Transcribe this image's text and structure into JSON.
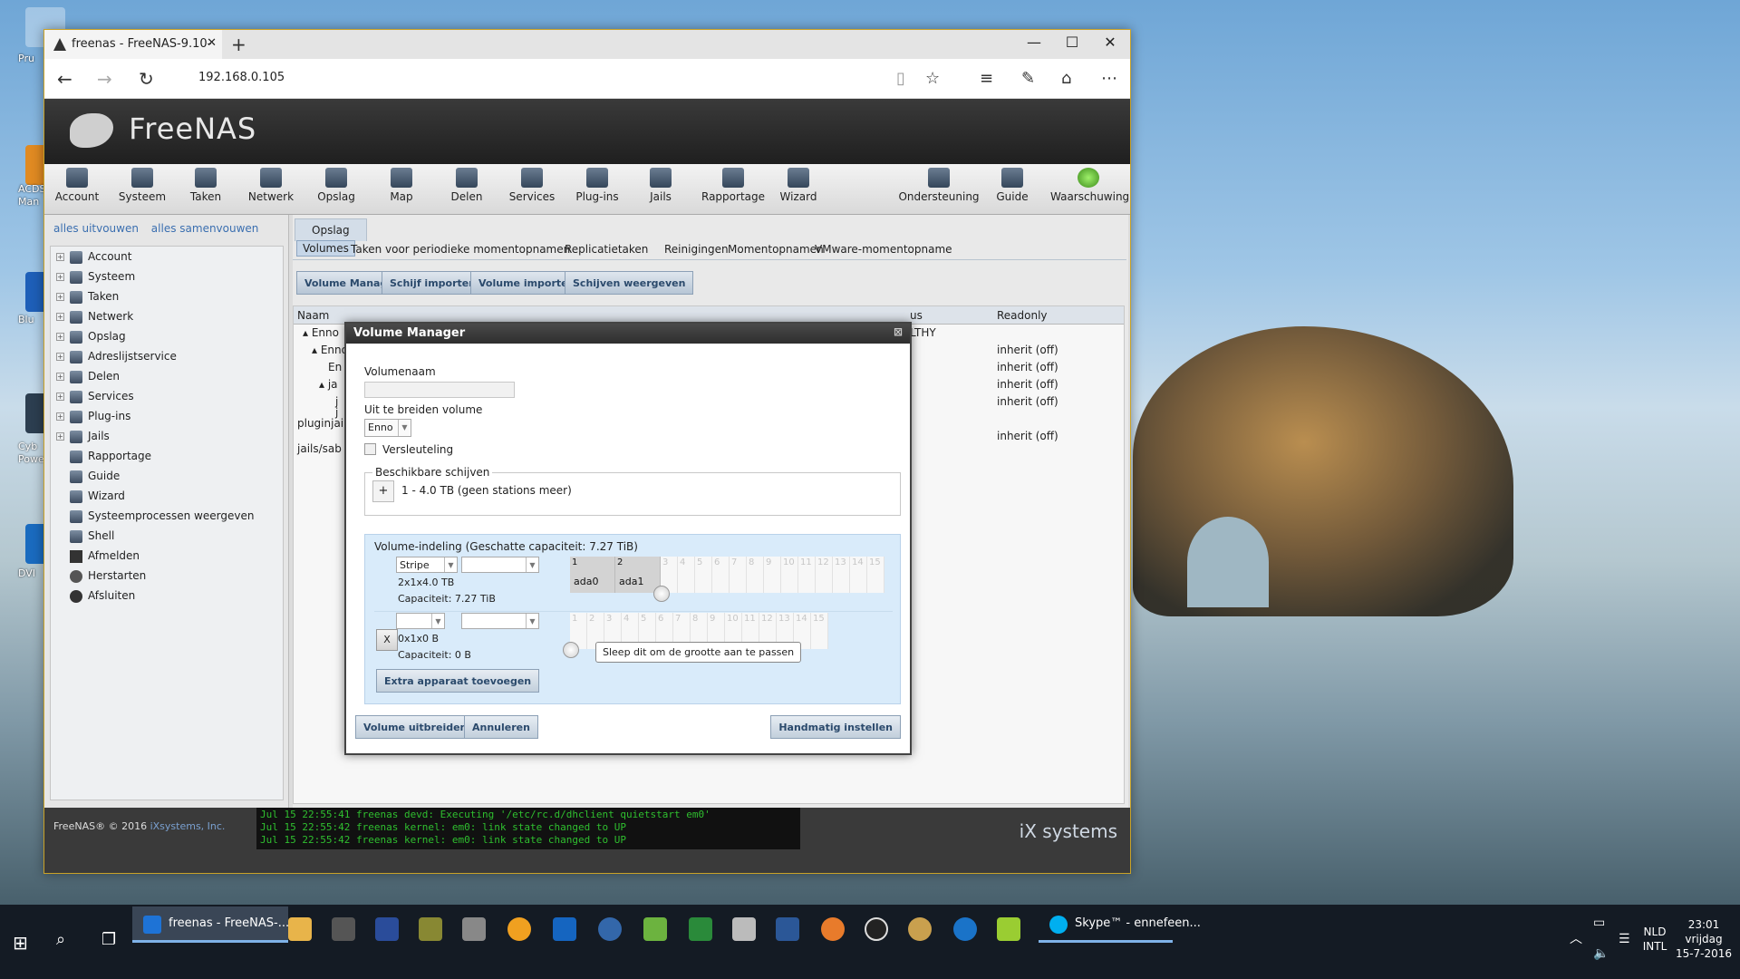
{
  "browser": {
    "tab_title": "freenas - FreeNAS-9.10-",
    "url": "192.168.0.105"
  },
  "freenas": {
    "logo_text": "FreeNAS",
    "toolbar": [
      "Account",
      "Systeem",
      "Taken",
      "Netwerk",
      "Opslag",
      "Map",
      "Delen",
      "Services",
      "Plug-ins",
      "Jails",
      "Rapportage",
      "Wizard",
      "Ondersteuning",
      "Guide",
      "Waarschuwing"
    ],
    "left_links": {
      "expand": "alles uitvouwen",
      "collapse": "alles samenvouwen"
    },
    "tree": [
      "Account",
      "Systeem",
      "Taken",
      "Netwerk",
      "Opslag",
      "Adreslijstservice",
      "Delen",
      "Services",
      "Plug-ins",
      "Jails",
      "Rapportage",
      "Guide",
      "Wizard",
      "Systeemprocessen weergeven",
      "Shell",
      "Afmelden",
      "Herstarten",
      "Afsluiten"
    ],
    "main_tab": "Opslag",
    "subtabs": [
      "Volumes",
      "Taken voor periodieke momentopnamen",
      "Replicatietaken",
      "Reinigingen",
      "Momentopnamen",
      "VMware-momentopname"
    ],
    "buttons": [
      "Volume Manager",
      "Schijf importeren",
      "Volume importeren",
      "Schijven weergeven"
    ],
    "grid": {
      "col_name": "Naam",
      "col_status": "us",
      "col_readonly": "Readonly",
      "rows": [
        {
          "name": "Enno",
          "status": "LTHY",
          "readonly": ""
        },
        {
          "name": "Enno",
          "status": "",
          "readonly": "inherit (off)"
        },
        {
          "name": "En",
          "status": "",
          "readonly": "inherit (off)"
        },
        {
          "name": "ja",
          "status": "",
          "readonly": "inherit (off)"
        },
        {
          "name": "j",
          "status": "",
          "readonly": "inherit (off)"
        },
        {
          "name": "j",
          "status": "",
          "readonly": ""
        },
        {
          "name": "pluginjai",
          "status": "",
          "readonly": ""
        },
        {
          "name": "jails/sab",
          "status": "",
          "readonly": "inherit (off)"
        }
      ]
    },
    "footer": {
      "copyright": "FreeNAS® © 2016",
      "company": "iXsystems, Inc.",
      "console": [
        "Jul 15 22:55:41 freenas devd: Executing '/etc/rc.d/dhclient quietstart em0'",
        "Jul 15 22:55:42 freenas kernel: em0: link state changed to UP",
        "Jul 15 22:55:42 freenas kernel: em0: link state changed to UP"
      ],
      "vendor_logo": "iX systems"
    }
  },
  "modal": {
    "title": "Volume Manager",
    "volume_name_label": "Volumenaam",
    "volume_name_value": "",
    "extend_label": "Uit te breiden volume",
    "extend_value": "Enno",
    "encryption_label": "Versleuteling",
    "available_label": "Beschikbare schijven",
    "available_disk": "1 - 4.0 TB (geen stations meer)",
    "layout_label": "Volume-indeling (Geschatte capaciteit: 7.27 TiB)",
    "row1": {
      "type": "Stripe",
      "config": "2x1x4.0 TB",
      "capacity": "Capaciteit: 7.27 TiB",
      "slots": [
        "1",
        "2",
        "3",
        "4",
        "5",
        "6",
        "7",
        "8",
        "9",
        "10",
        "11",
        "12",
        "13",
        "14",
        "15"
      ],
      "disks": [
        "ada0",
        "ada1"
      ]
    },
    "row2": {
      "remove_label": "X",
      "config": "0x1x0 B",
      "capacity": "Capaciteit: 0 B",
      "slots": [
        "1",
        "2",
        "3",
        "4",
        "5",
        "6",
        "7",
        "8",
        "9",
        "10",
        "11",
        "12",
        "13",
        "14",
        "15"
      ]
    },
    "tooltip": "Sleep dit om de grootte aan te passen",
    "add_device": "Extra apparaat toevoegen",
    "btn_extend": "Volume uitbreiden",
    "btn_cancel": "Annuleren",
    "btn_manual": "Handmatig instellen"
  },
  "taskbar": {
    "apps": [
      {
        "label": "freenas - FreeNAS-...",
        "color": "#1e73d6"
      },
      {
        "label": "Skype™ - ennefeen...",
        "color": "#00aff0"
      }
    ],
    "lang1": "NLD",
    "lang2": "INTL",
    "time": "23:01",
    "day": "vrijdag",
    "date": "15-7-2016"
  },
  "desktop_labels": [
    "Pru",
    "ACDS",
    "Man",
    "Blu",
    "Cyb",
    "Powe",
    "DVI"
  ]
}
